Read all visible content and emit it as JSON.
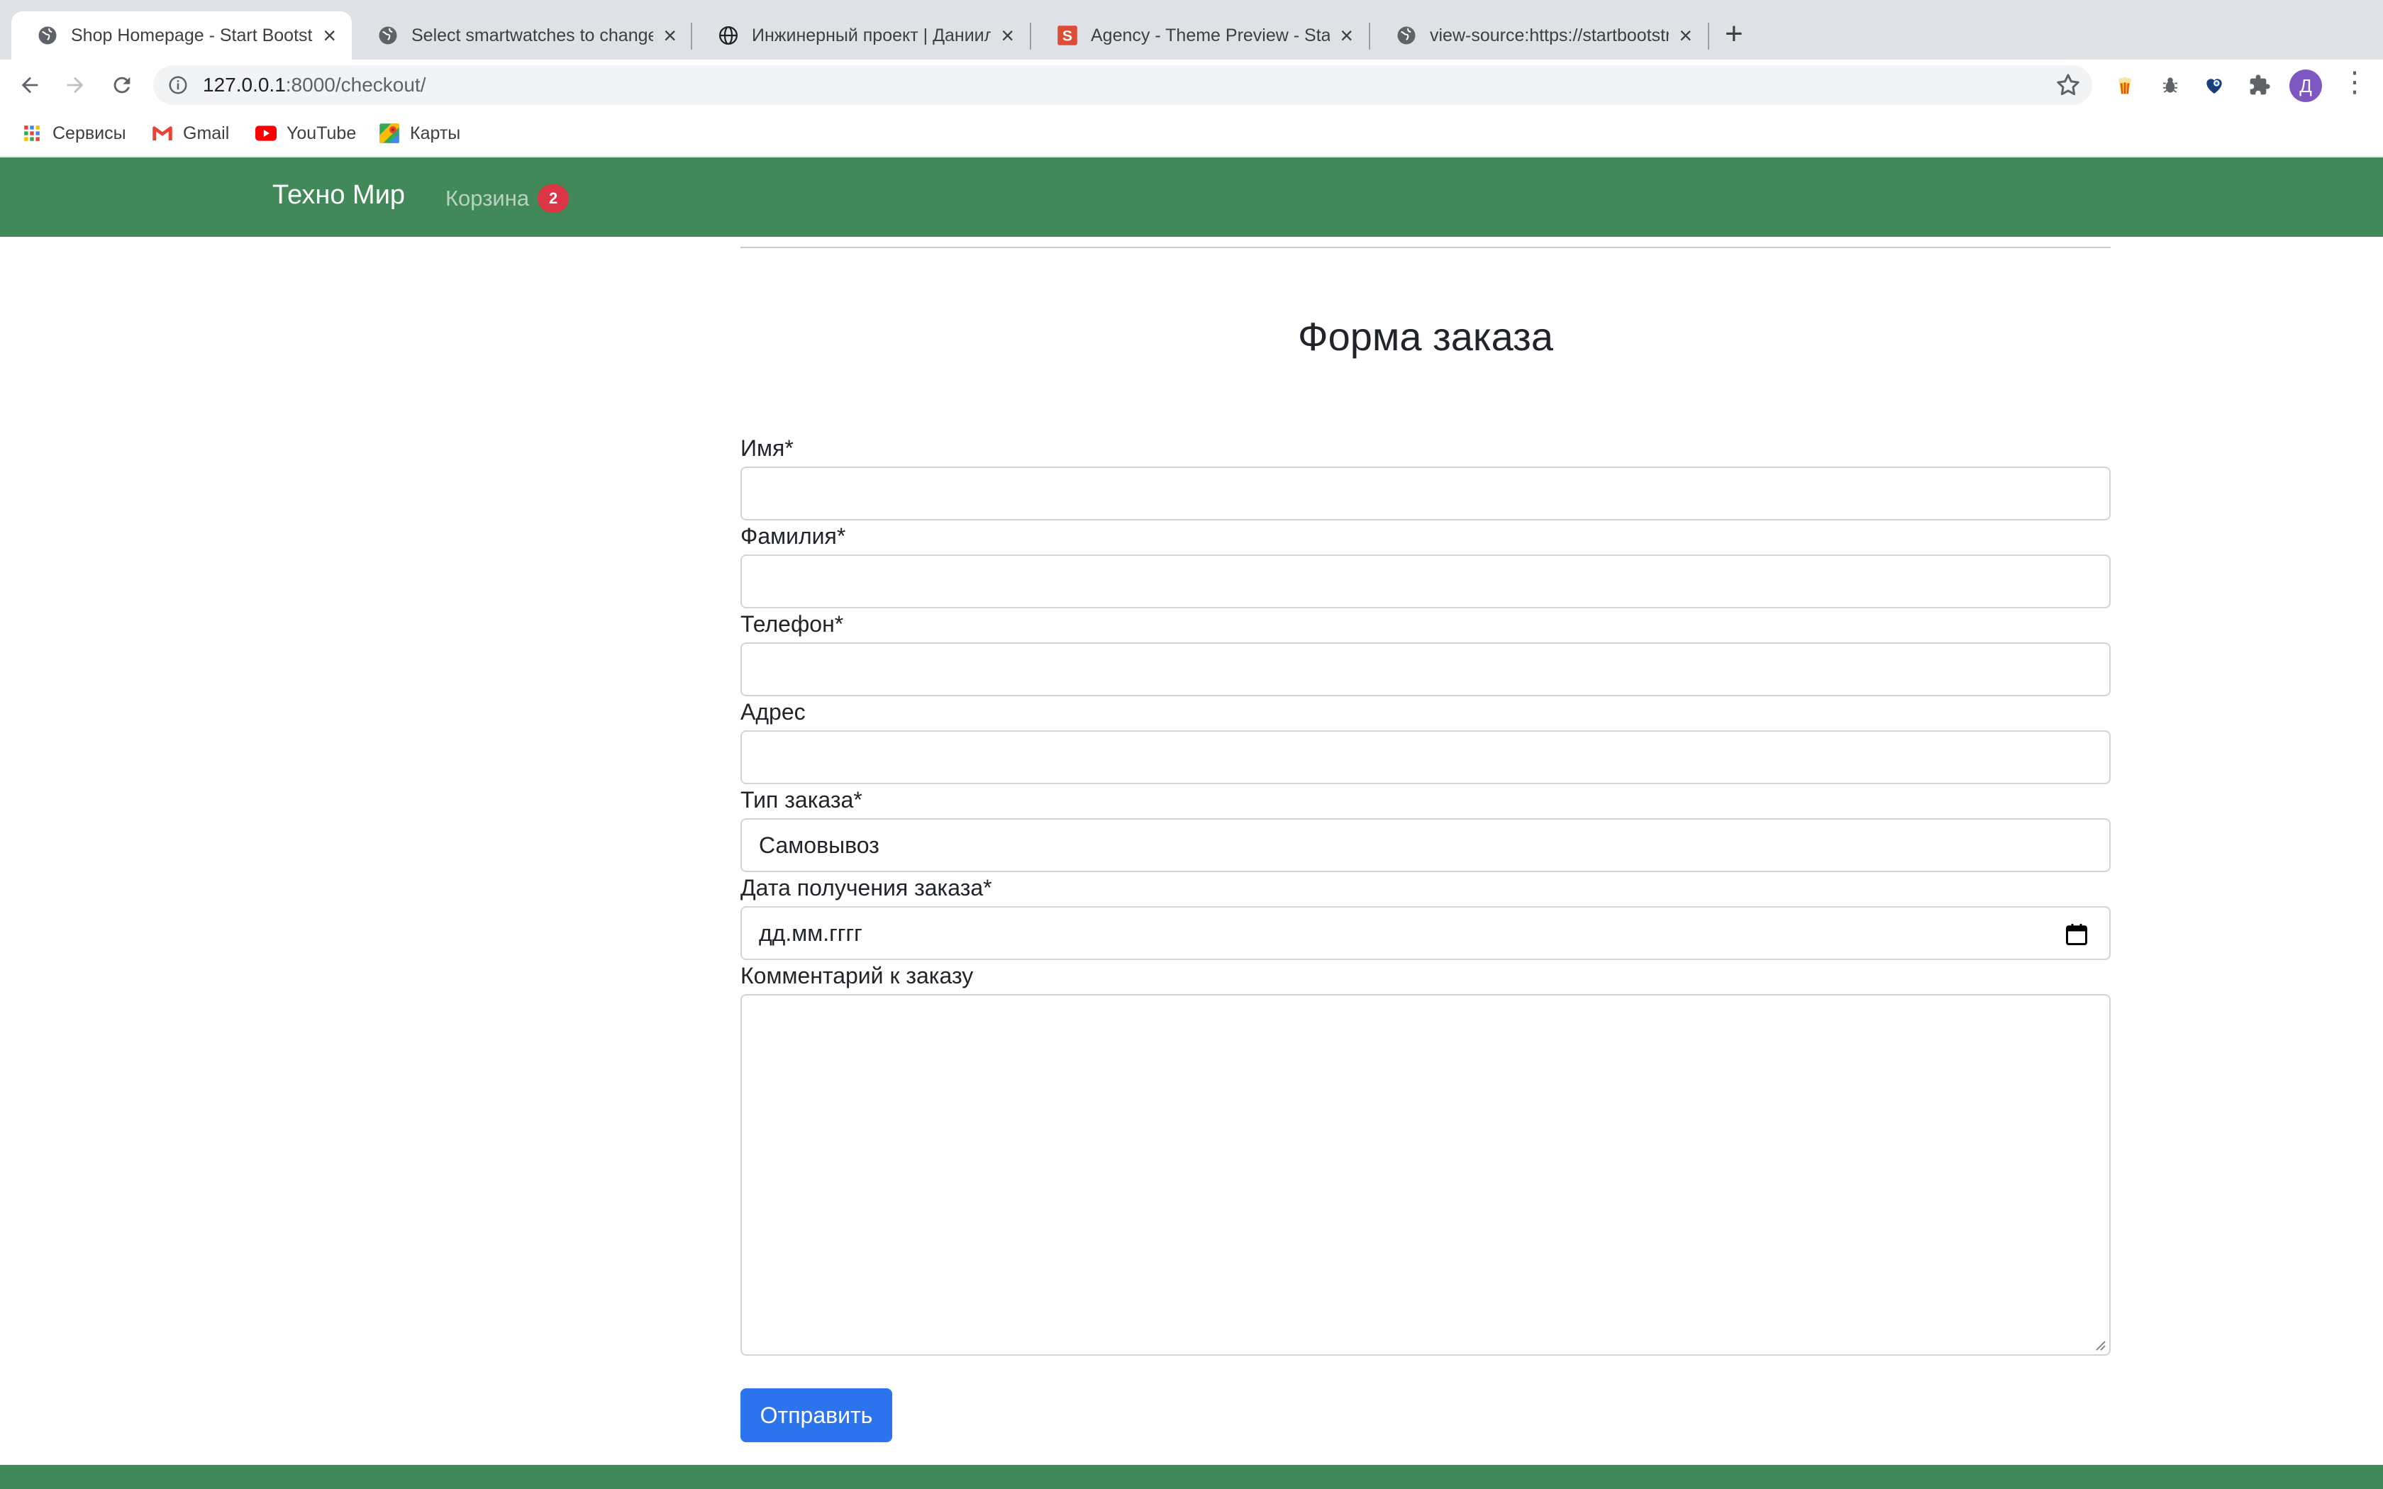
{
  "browser": {
    "tabs": [
      {
        "title": "Shop Homepage - Start Bootstrap",
        "active": true,
        "icon": "globe-icon"
      },
      {
        "title": "Select smartwatches to change",
        "active": false,
        "icon": "globe-icon"
      },
      {
        "title": "Инжинерный проект | Даниил",
        "active": false,
        "icon": "globe-icon"
      },
      {
        "title": "Agency - Theme Preview - Start",
        "active": false,
        "icon": "startbootstrap-icon"
      },
      {
        "title": "view-source:https://startbootstrap",
        "active": false,
        "icon": "globe-icon"
      }
    ],
    "address": {
      "host": "127.0.0.1",
      "path": ":8000/checkout/"
    },
    "profile_initial": "Д",
    "bookmarks": [
      {
        "label": "Сервисы",
        "icon": "apps-grid-icon"
      },
      {
        "label": "Gmail",
        "icon": "gmail-icon"
      },
      {
        "label": "YouTube",
        "icon": "youtube-icon"
      },
      {
        "label": "Карты",
        "icon": "maps-icon"
      }
    ]
  },
  "navbar": {
    "brand": "Техно Мир",
    "cart_label": "Корзина",
    "cart_count": "2",
    "color": "#428959"
  },
  "form": {
    "title": "Форма заказа",
    "fields": {
      "first_name": {
        "label": "Имя*",
        "value": ""
      },
      "last_name": {
        "label": "Фамилия*",
        "value": ""
      },
      "phone": {
        "label": "Телефон*",
        "value": ""
      },
      "address": {
        "label": "Адрес",
        "value": ""
      },
      "order_type": {
        "label": "Тип заказа*",
        "value": "Самовывоз"
      },
      "date": {
        "label": "Дата получения заказа*",
        "value": "дд.мм.гггг"
      },
      "comment": {
        "label": "Комментарий к заказу",
        "value": ""
      }
    },
    "submit_label": "Отправить",
    "submit_color": "#2c74ee"
  }
}
